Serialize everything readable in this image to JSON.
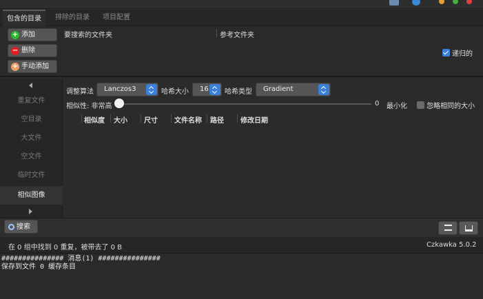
{
  "tabs": [
    {
      "label": "包含的目录",
      "active": true
    },
    {
      "label": "排除的目录",
      "active": false
    },
    {
      "label": "项目配置",
      "active": false
    }
  ],
  "dirs": {
    "add": "添加",
    "remove": "删除",
    "manual_add": "手动添加",
    "col_search": "要搜索的文件夹",
    "col_reference": "参考文件夹",
    "recursive": "递归的",
    "recursive_checked": true
  },
  "nav": {
    "items": [
      "重复文件",
      "空目录",
      "大文件",
      "空文件",
      "临时文件",
      "相似图像"
    ],
    "active_index": 5
  },
  "options": {
    "resize_label": "调整算法",
    "resize_value": "Lanczos3",
    "hash_size_label": "哈希大小",
    "hash_size_value": "16",
    "hash_type_label": "哈希类型",
    "hash_type_value": "Gradient",
    "similarity_label": "相似性: 非常高",
    "slider_value": "0",
    "slider_fraction": 0.0,
    "minimize": "最小化",
    "ignore_same_size": "忽略相同的大小",
    "ignore_same_size_checked": false
  },
  "table": {
    "columns": [
      "相似度",
      "大小",
      "尺寸",
      "文件名称",
      "路径",
      "修改日期"
    ]
  },
  "bottom": {
    "search": "搜索"
  },
  "status": {
    "text": "在 0 组中找到 0 重复，被带去了 0 B",
    "version": "Czkawka 5.0.2"
  },
  "log": {
    "line1": "############### 消息(1) ###############",
    "line2": "保存到文件 0 缓存条目"
  },
  "colors": {
    "accent": "#3a80d8",
    "add_icon": "#2db82d",
    "remove_icon": "#e02020",
    "manual_icon": "#e8a06a"
  }
}
